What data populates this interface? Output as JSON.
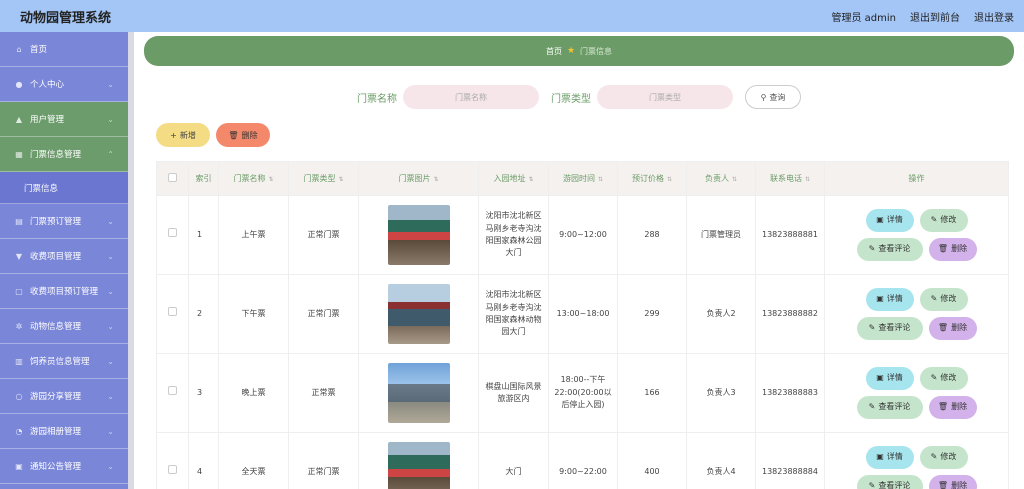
{
  "app": {
    "title": "动物园管理系统"
  },
  "header": {
    "user": "管理员 admin",
    "back_front": "退出到前台",
    "logout": "退出登录"
  },
  "sidebar": {
    "items": [
      {
        "label": "首页",
        "icon": "home-icon",
        "arrow": false
      },
      {
        "label": "个人中心",
        "icon": "user-icon",
        "arrow": true
      },
      {
        "label": "用户管理",
        "icon": "users-icon",
        "arrow": true
      },
      {
        "label": "门票信息管理",
        "icon": "grid-icon",
        "arrow": true,
        "active": true
      },
      {
        "label": "门票预订管理",
        "icon": "ticket-icon",
        "arrow": true
      },
      {
        "label": "收费项目管理",
        "icon": "funnel-icon",
        "arrow": true
      },
      {
        "label": "收费项目预订管理",
        "icon": "doc-icon",
        "arrow": true
      },
      {
        "label": "动物信息管理",
        "icon": "gear-icon",
        "arrow": true
      },
      {
        "label": "饲养员信息管理",
        "icon": "id-icon",
        "arrow": true
      },
      {
        "label": "游园分享管理",
        "icon": "share-icon",
        "arrow": true
      },
      {
        "label": "游园相册管理",
        "icon": "album-icon",
        "arrow": true
      },
      {
        "label": "通知公告管理",
        "icon": "notice-icon",
        "arrow": true
      }
    ],
    "sub_item": "门票信息"
  },
  "breadcrumb": {
    "home": "首页",
    "current": "门票信息"
  },
  "search": {
    "name_label": "门票名称",
    "name_placeholder": "门票名称",
    "type_label": "门票类型",
    "type_placeholder": "门票类型",
    "button": "查询"
  },
  "actions": {
    "add": "新增",
    "delete": "删除"
  },
  "table": {
    "headers": [
      "索引",
      "门票名称",
      "门票类型",
      "门票图片",
      "入园地址",
      "游园时间",
      "预订价格",
      "负责人",
      "联系电话",
      "操作"
    ],
    "rows": [
      {
        "index": "1",
        "name": "上午票",
        "type": "正常门票",
        "address": "沈阳市沈北新区马刚乡老寺沟沈阳国家森林公园大门",
        "time": "9:00~12:00",
        "price": "288",
        "owner": "门票管理员",
        "phone": "13823888881"
      },
      {
        "index": "2",
        "name": "下午票",
        "type": "正常门票",
        "address": "沈阳市沈北新区马刚乡老寺沟沈阳国家森林动物园大门",
        "time": "13:00~18:00",
        "price": "299",
        "owner": "负责人2",
        "phone": "13823888882"
      },
      {
        "index": "3",
        "name": "晚上票",
        "type": "正常票",
        "address": "棋盘山国际风景旅游区内",
        "time": "18:00--下午22:00(20:00以后停止入园)",
        "price": "166",
        "owner": "负责人3",
        "phone": "13823888883"
      },
      {
        "index": "4",
        "name": "全天票",
        "type": "正常门票",
        "address": "大门",
        "time": "9:00~22:00",
        "price": "400",
        "owner": "负责人4",
        "phone": "13823888884"
      }
    ],
    "ops": {
      "detail": "详情",
      "edit": "修改",
      "review": "查看评论",
      "delete": "删除"
    }
  }
}
